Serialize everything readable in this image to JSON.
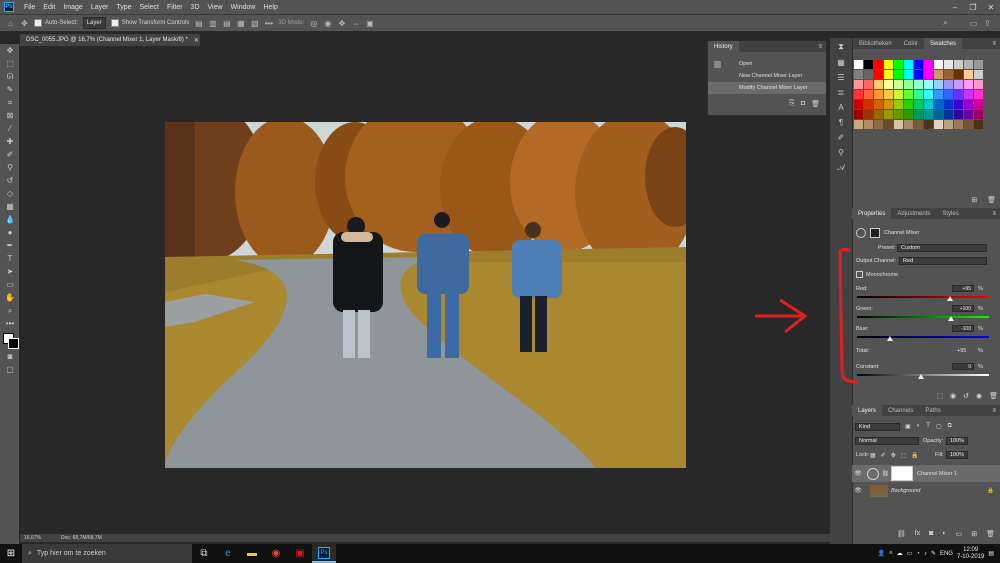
{
  "menubar": {
    "items": [
      "File",
      "Edit",
      "Image",
      "Layer",
      "Type",
      "Select",
      "Filter",
      "3D",
      "View",
      "Window",
      "Help"
    ],
    "logo": "Ps"
  },
  "options": {
    "auto_select_label": "Auto-Select:",
    "auto_select_value": "Layer",
    "transform_label": "Show Transform Controls",
    "mode_3d": "3D Mode:"
  },
  "document": {
    "tab_title": "DSC_0055.JPG @ 16,7% (Channel Mixer 1, Layer Mask/8) *",
    "zoom": "16,67%",
    "doc_size": "Doc: 68,7M/68,7M"
  },
  "history": {
    "title": "History",
    "items": [
      "Open",
      "New Channel Mixer Layer",
      "Modify Channel Mixer Layer"
    ]
  },
  "swatch_tabs": [
    "Bibliotheken",
    "Color",
    "Swatches"
  ],
  "swatch_colors": [
    "#ffffff",
    "#000000",
    "#ff0000",
    "#ffff00",
    "#00ff00",
    "#00ffff",
    "#0000ff",
    "#ff00ff",
    "#ffffff",
    "#e6e6e6",
    "#cccccc",
    "#b3b3b3",
    "#999999",
    "#808080",
    "#666666",
    "#ff0000",
    "#ffff00",
    "#00ff00",
    "#00ffff",
    "#0000ff",
    "#ff00ff",
    "#cc9966",
    "#996633",
    "#663300",
    "#ffcc99",
    "#cccccc",
    "#ff9999",
    "#ff6666",
    "#ffcc66",
    "#ffff99",
    "#ccff99",
    "#99ff99",
    "#99ffcc",
    "#99ffff",
    "#99ccff",
    "#9999ff",
    "#cc99ff",
    "#ff99ff",
    "#ff99cc",
    "#ff3333",
    "#ff6633",
    "#ff9933",
    "#ffcc33",
    "#ccff33",
    "#66ff33",
    "#33ff99",
    "#33ffff",
    "#3399ff",
    "#3366ff",
    "#6633ff",
    "#cc33ff",
    "#ff33cc",
    "#cc0000",
    "#cc3300",
    "#cc6600",
    "#cc9900",
    "#99cc00",
    "#33cc00",
    "#00cc66",
    "#00cccc",
    "#0066cc",
    "#0033cc",
    "#3300cc",
    "#9900cc",
    "#cc0099",
    "#990000",
    "#993300",
    "#996600",
    "#999900",
    "#669900",
    "#339900",
    "#009966",
    "#009999",
    "#006699",
    "#003399",
    "#330099",
    "#660099",
    "#990066",
    "#c8a882",
    "#b08c6a",
    "#8c6a4a",
    "#6a4a2a",
    "#d9c2a6",
    "#a68a6a",
    "#7a5c3c",
    "#4a3420",
    "#e6d2bc",
    "#bfa080",
    "#997a5a",
    "#735236",
    "#4d3018"
  ],
  "properties": {
    "tabs": [
      "Properties",
      "Adjustments",
      "Styles"
    ],
    "adjustment_name": "Channel Mixer",
    "preset_label": "Preset:",
    "preset_value": "Custom",
    "output_label": "Output Channel:",
    "output_value": "Red",
    "monochrome_label": "Monochrome",
    "red_label": "Red:",
    "red_value": "+95",
    "green_label": "Green:",
    "green_value": "+100",
    "blue_label": "Blue:",
    "blue_value": "-100",
    "total_label": "Total:",
    "total_value": "+95",
    "constant_label": "Constant:",
    "constant_value": "0",
    "pct": "%",
    "red_level": 95,
    "green_level": 100,
    "blue_level": -100,
    "constant_level": 0
  },
  "layers": {
    "tabs": [
      "Layers",
      "Channels",
      "Paths"
    ],
    "kind": "Kind",
    "blend": "Normal",
    "opacity_label": "Opacity:",
    "opacity_value": "100%",
    "lock_label": "Lock:",
    "fill_label": "Fill:",
    "fill_value": "100%",
    "items": [
      "Channel Mixer 1",
      "Background"
    ]
  },
  "taskbar": {
    "search_placeholder": "Typ hier om te zoeken",
    "lang": "ENG",
    "time": "12:09",
    "date": "7-10-2019"
  },
  "colors": {
    "annotation": "#e02020",
    "accent": "#31a8ff"
  }
}
